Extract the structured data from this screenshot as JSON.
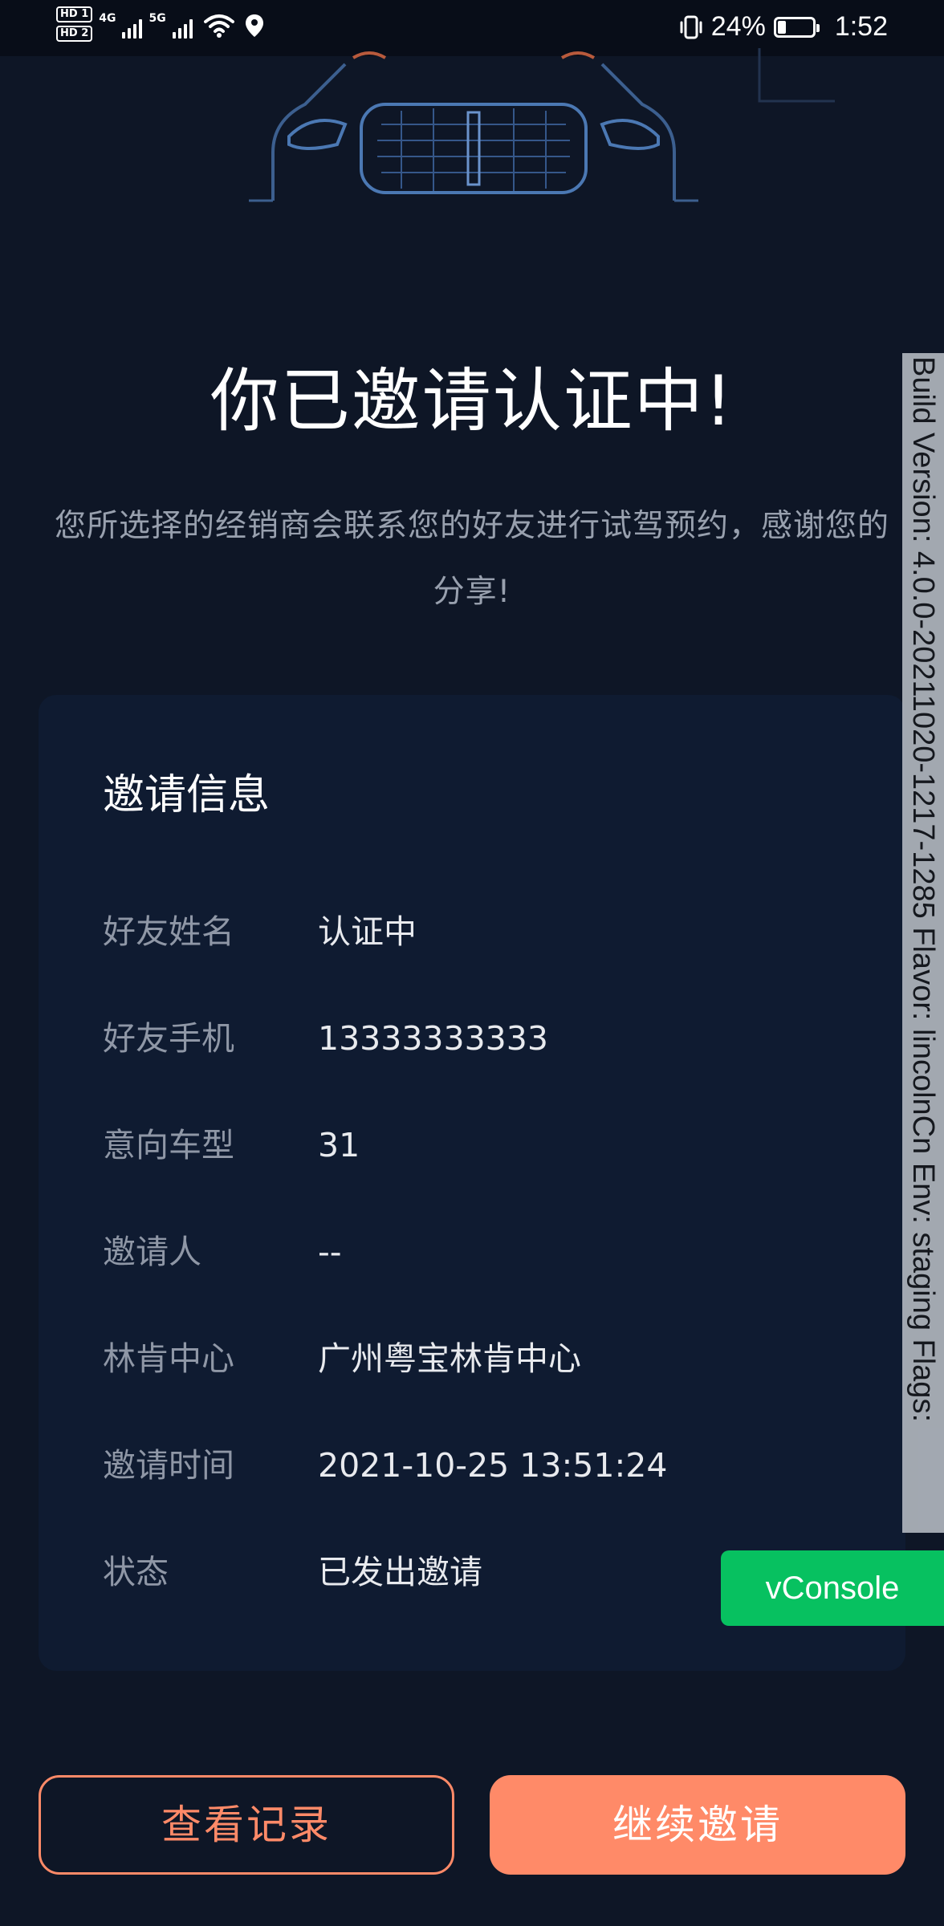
{
  "status_bar": {
    "hd1": "HD 1",
    "hd2": "HD 2",
    "net1": "4G",
    "net2": "5G",
    "battery_percent": "24%",
    "battery_level": 0.24,
    "time": "1:52"
  },
  "header": {
    "title": "你已邀请认证中!",
    "subtitle": "您所选择的经销商会联系您的好友进行试驾预约，感谢您的分享!"
  },
  "card": {
    "title": "邀请信息",
    "rows": [
      {
        "label": "好友姓名",
        "value": "认证中"
      },
      {
        "label": "好友手机",
        "value": "13333333333"
      },
      {
        "label": "意向车型",
        "value": "31"
      },
      {
        "label": "邀请人",
        "value": "--"
      },
      {
        "label": "林肯中心",
        "value": "广州粤宝林肯中心"
      },
      {
        "label": "邀请时间",
        "value": "2021-10-25 13:51:24"
      },
      {
        "label": "状态",
        "value": "已发出邀请"
      }
    ]
  },
  "debug": {
    "vconsole_label": "vConsole",
    "build_info": "Build Version: 4.0.0-20211020-1217-1285 Flavor: lincolnCn Env: staging Flags:"
  },
  "actions": {
    "records_label": "查看记录",
    "continue_label": "继续邀请"
  },
  "colors": {
    "background": "#0e1626",
    "card": "#0f1b31",
    "accent": "#ff8a68",
    "vconsole": "#07c160"
  },
  "icons": [
    "wifi-icon",
    "location-icon",
    "vibrate-icon",
    "battery-icon",
    "car-illustration"
  ]
}
